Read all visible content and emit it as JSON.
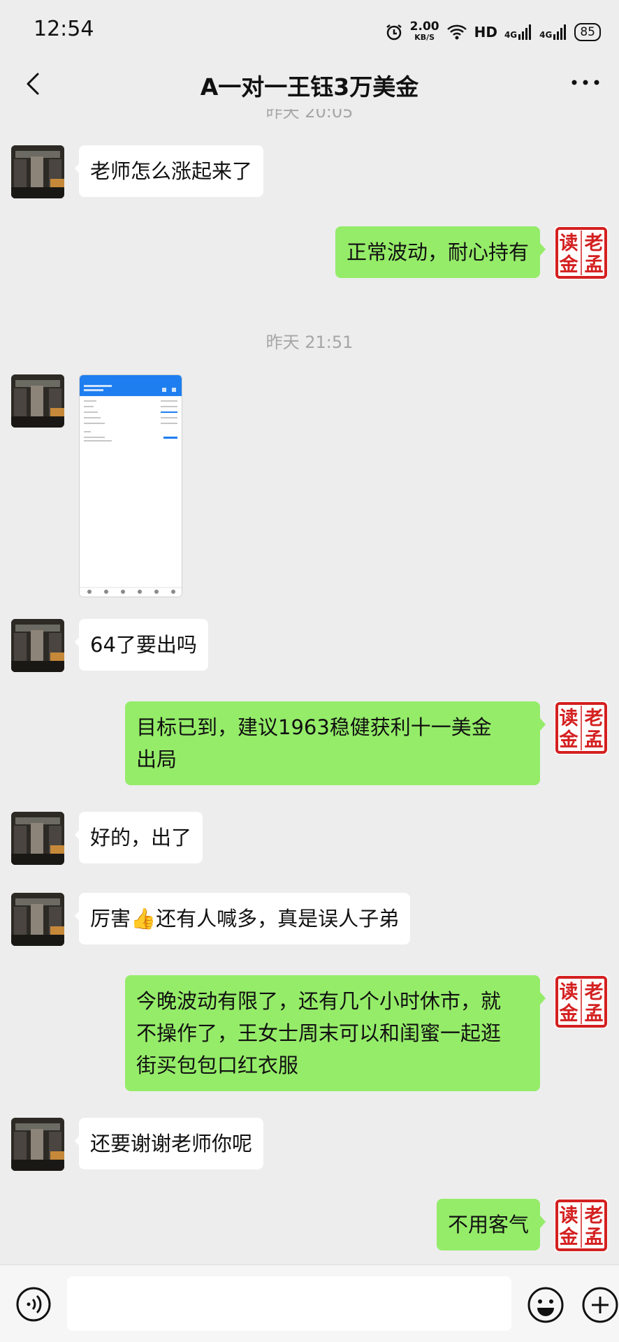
{
  "status_bar": {
    "time": "12:54",
    "net_speed_value": "2.00",
    "net_speed_unit": "KB/S",
    "hd_label": "HD",
    "signal1": "4G",
    "signal2": "4G",
    "battery": "85"
  },
  "header": {
    "title": "A一对一王钰3万美金"
  },
  "colors": {
    "background": "#ededed",
    "outgoing_bubble": "#95ec69",
    "incoming_bubble": "#ffffff",
    "seal_red": "#d42020"
  },
  "messages": {
    "ts0": "昨天 20:05",
    "m1": "老师怎么涨起来了",
    "m2": "正常波动，耐心持有",
    "ts1": "昨天 21:51",
    "m4": "64了要出吗",
    "m5_line1": "目标已到，建议1963稳健获利十一美金",
    "m5_line2": "出局",
    "m6": "好的，出了",
    "m7_pre": "厉害",
    "m7_emoji": "👍",
    "m7_post": "还有人喊多，真是误人子弟",
    "m8_line1": "今晚波动有限了，还有几个小时休市，就",
    "m8_line2": "不操作了，王女士周末可以和闺蜜一起逛",
    "m8_line3": "街买包包口红衣服",
    "m9": "还要谢谢老师你呢",
    "m10": "不用客气"
  },
  "seal": {
    "c1": "老",
    "c2": "读",
    "c3": "孟",
    "c4": "金"
  }
}
